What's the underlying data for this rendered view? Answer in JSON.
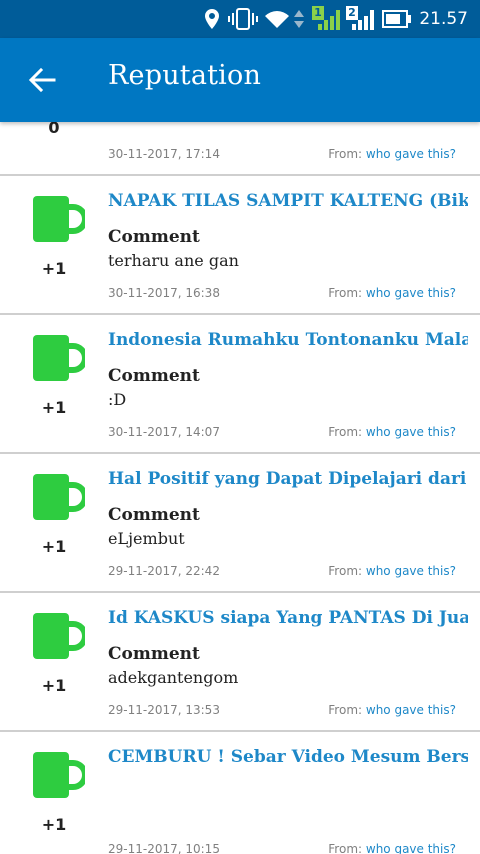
{
  "status_bar": {
    "time": "21.57",
    "sim1": "1",
    "sim2": "2",
    "icons": [
      "location-icon",
      "vibrate-icon",
      "wifi-icon",
      "data-arrows-icon",
      "signal-sim1-icon",
      "signal-sim2-icon",
      "battery-icon"
    ]
  },
  "app_bar": {
    "title": "Reputation",
    "back_icon": "arrow-left-icon"
  },
  "colors": {
    "app_bar": "#0077c2",
    "status_bar": "#005c99",
    "link": "#1e88c8",
    "mug_green": "#2ecc40"
  },
  "from_label": "From: ",
  "who_label": "who gave this?",
  "comment_label": "Comment",
  "partial_item": {
    "score": "0",
    "date": "30-11-2017, 17:14"
  },
  "items": [
    {
      "title": "NAPAK TILAS SAMPIT KALTENG (Bikin",
      "comment": "terharu ane gan",
      "score": "+1",
      "date": "30-11-2017, 16:38"
    },
    {
      "title": "Indonesia Rumahku Tontonanku Malaysia",
      "comment": ":D",
      "score": "+1",
      "date": "30-11-2017, 14:07"
    },
    {
      "title": "Hal Positif yang Dapat Dipelajari dari Kisah",
      "comment": "eLjembut",
      "score": "+1",
      "date": "29-11-2017, 22:42"
    },
    {
      "title": "Id KASKUS siapa Yang PANTAS Di Jual",
      "comment": "adekgantengom",
      "score": "+1",
      "date": "29-11-2017, 13:53"
    },
    {
      "title": "CEMBURU ! Sebar Video Mesum Bersama",
      "comment": "",
      "score": "+1",
      "date": "29-11-2017, 10:15"
    }
  ]
}
